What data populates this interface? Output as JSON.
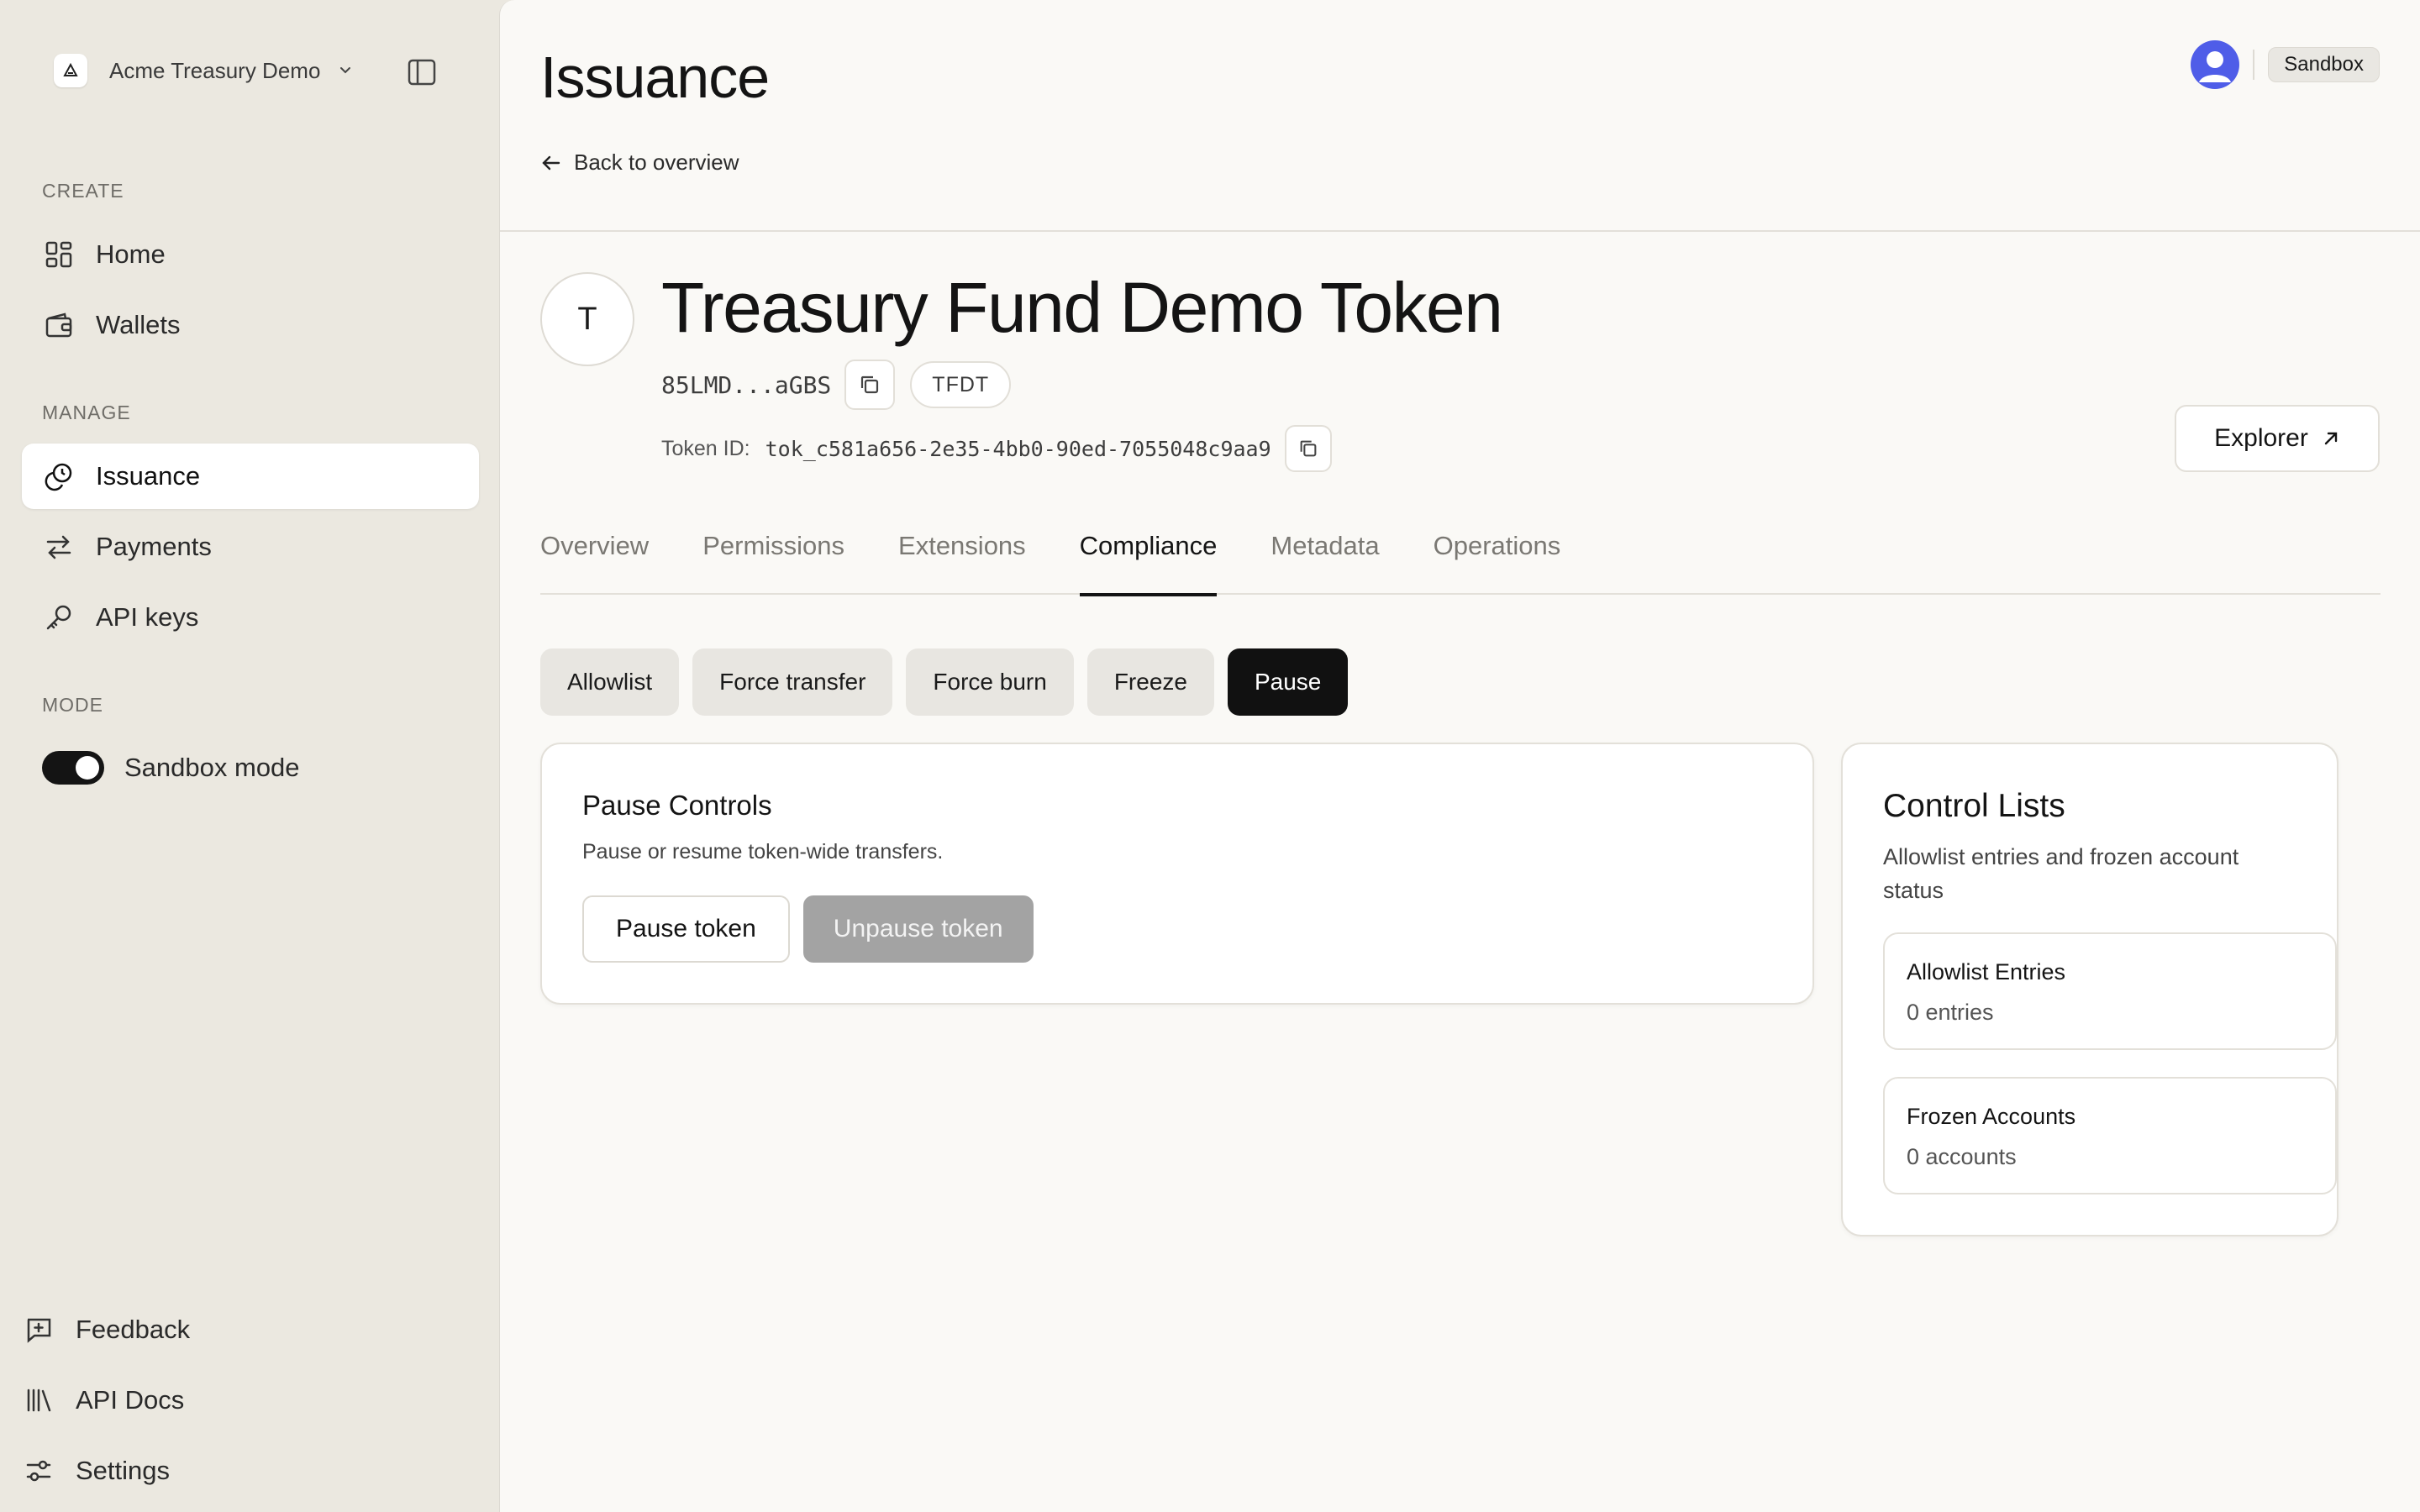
{
  "sidebar": {
    "workspace_name": "Acme Treasury Demo",
    "sections": {
      "create": "CREATE",
      "manage": "MANAGE",
      "mode": "MODE"
    },
    "items": {
      "home": "Home",
      "wallets": "Wallets",
      "issuance": "Issuance",
      "payments": "Payments",
      "api_keys": "API keys"
    },
    "mode_toggle": {
      "label": "Sandbox mode",
      "on": true
    },
    "bottom": {
      "feedback": "Feedback",
      "api_docs": "API Docs",
      "settings": "Settings"
    }
  },
  "header": {
    "title": "Issuance",
    "back_label": "Back to overview",
    "env_badge": "Sandbox",
    "avatar_color": "#4f5de8"
  },
  "token": {
    "avatar_letter": "T",
    "name": "Treasury Fund Demo Token",
    "address_short": "85LMD...aGBS",
    "ticker": "TFDT",
    "token_id_label": "Token ID:",
    "token_id": "tok_c581a656-2e35-4bb0-90ed-7055048c9aa9",
    "explorer_label": "Explorer"
  },
  "tabs": [
    "Overview",
    "Permissions",
    "Extensions",
    "Compliance",
    "Metadata",
    "Operations"
  ],
  "active_tab": "Compliance",
  "subtabs": [
    "Allowlist",
    "Force transfer",
    "Force burn",
    "Freeze",
    "Pause"
  ],
  "active_subtab": "Pause",
  "pause_card": {
    "title": "Pause Controls",
    "description": "Pause or resume token-wide transfers.",
    "pause_button": "Pause token",
    "unpause_button": "Unpause token"
  },
  "control_lists": {
    "title": "Control Lists",
    "description": "Allowlist entries and frozen account status",
    "allowlist": {
      "title": "Allowlist Entries",
      "value": "0 entries"
    },
    "frozen": {
      "title": "Frozen Accounts",
      "value": "0 accounts"
    }
  },
  "colors": {
    "sidebar_bg": "#ebe8e0",
    "main_bg": "#faf9f6",
    "accent_dark": "#111111",
    "disabled_button": "#a3a3a3"
  }
}
